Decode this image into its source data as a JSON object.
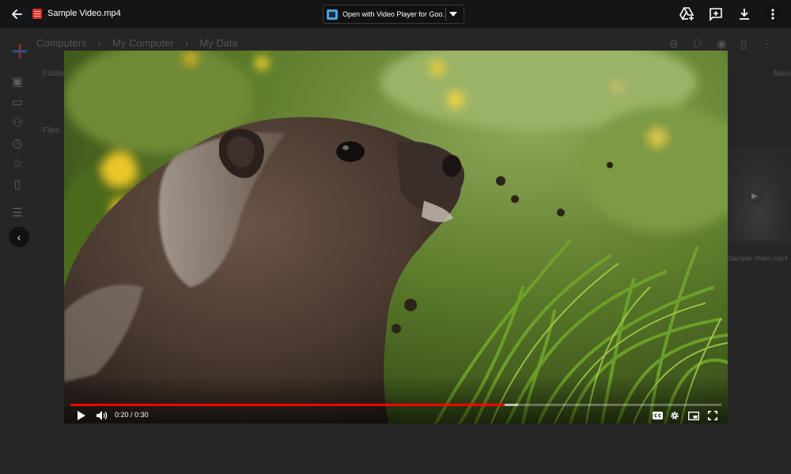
{
  "topbar": {
    "file_title": "Sample Video.mp4",
    "open_with_label": "Open with Video Player for Goo..."
  },
  "background": {
    "breadcrumbs": [
      "Computers",
      "My Computer",
      "My Data"
    ],
    "folders_label": "Folders",
    "files_label": "Files",
    "name_label": "Name",
    "thumb_filename": "Sample Video.mp4"
  },
  "player": {
    "current_time": "0:20",
    "duration": "0:30",
    "played_fraction": 0.667,
    "buffered_fraction": 0.688,
    "accent_color": "#ff0000"
  },
  "icons": {
    "back": "arrow-left-icon",
    "drive": "add-to-drive-icon",
    "comment": "add-comment-icon",
    "download": "download-icon",
    "more": "more-vert-icon",
    "play": "play-icon",
    "volume": "volume-icon",
    "captions": "cc-icon",
    "settings": "gear-icon",
    "miniplayer": "miniplayer-icon",
    "fullscreen": "fullscreen-icon"
  }
}
